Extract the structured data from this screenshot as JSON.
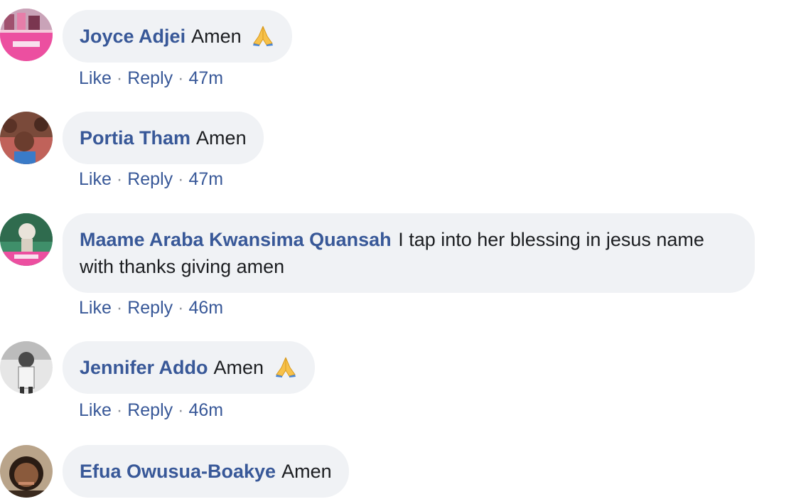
{
  "comments": [
    {
      "author": "Joyce Adjei",
      "text": "Amen",
      "emoji": "folded-hands-icon",
      "actions": {
        "like": "Like",
        "separator": "·",
        "reply": "Reply",
        "time": "47m"
      }
    },
    {
      "author": "Portia Tham",
      "text": "Amen",
      "emoji": "",
      "actions": {
        "like": "Like",
        "separator": "·",
        "reply": "Reply",
        "time": "47m"
      }
    },
    {
      "author": "Maame Araba Kwansima Quansah",
      "text": "I tap into her blessing in jesus name with thanks giving amen",
      "emoji": "",
      "actions": {
        "like": "Like",
        "separator": "·",
        "reply": "Reply",
        "time": "46m"
      }
    },
    {
      "author": "Jennifer Addo",
      "text": "Amen",
      "emoji": "folded-hands-icon",
      "actions": {
        "like": "Like",
        "separator": "·",
        "reply": "Reply",
        "time": "46m"
      }
    },
    {
      "author": "Efua Owusua-Boakye",
      "text": "Amen",
      "emoji": "",
      "actions": null
    }
  ],
  "colors": {
    "bubble_bg": "#f0f2f5",
    "name": "#385898",
    "text": "#1c1e21",
    "meta": "#90949c"
  }
}
